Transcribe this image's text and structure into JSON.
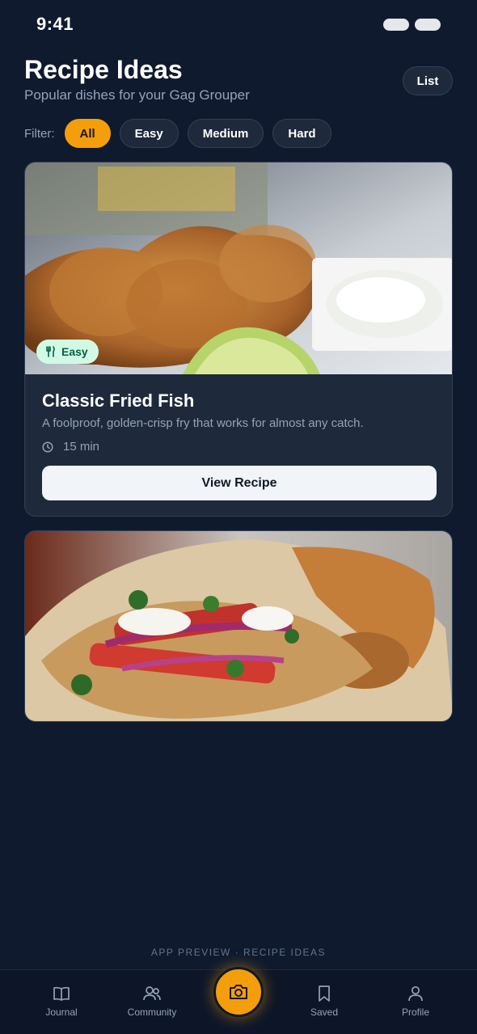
{
  "status_bar": {
    "time": "9:41"
  },
  "header": {
    "title": "Recipe Ideas",
    "subtitle": "Popular dishes for your Gag Grouper",
    "list_button": "List"
  },
  "filters": {
    "label": "Filter:",
    "options": [
      "All",
      "Easy",
      "Medium",
      "Hard"
    ],
    "selected": "All"
  },
  "recipes": [
    {
      "image": "fried-fish-photo",
      "difficulty": "Easy",
      "title": "Classic Fried Fish",
      "description": "A foolproof, golden-crisp fry that works for almost any catch.",
      "time": "15 min",
      "button": "View Recipe"
    },
    {
      "image": "fish-tacos-photo"
    }
  ],
  "footer_caption": "APP PREVIEW · RECIPE IDEAS",
  "bottom_nav": {
    "items": [
      {
        "label": "Journal",
        "icon": "book-icon"
      },
      {
        "label": "Community",
        "icon": "people-icon"
      },
      {
        "label": "Saved",
        "icon": "bookmark-icon"
      },
      {
        "label": "Profile",
        "icon": "user-icon"
      }
    ],
    "center_icon": "camera-icon"
  },
  "colors": {
    "background": "#0f1a2e",
    "accent": "#f59e0b",
    "card": "#1e293b",
    "easy_badge_bg": "#d1fae5",
    "easy_badge_text": "#065f46"
  }
}
